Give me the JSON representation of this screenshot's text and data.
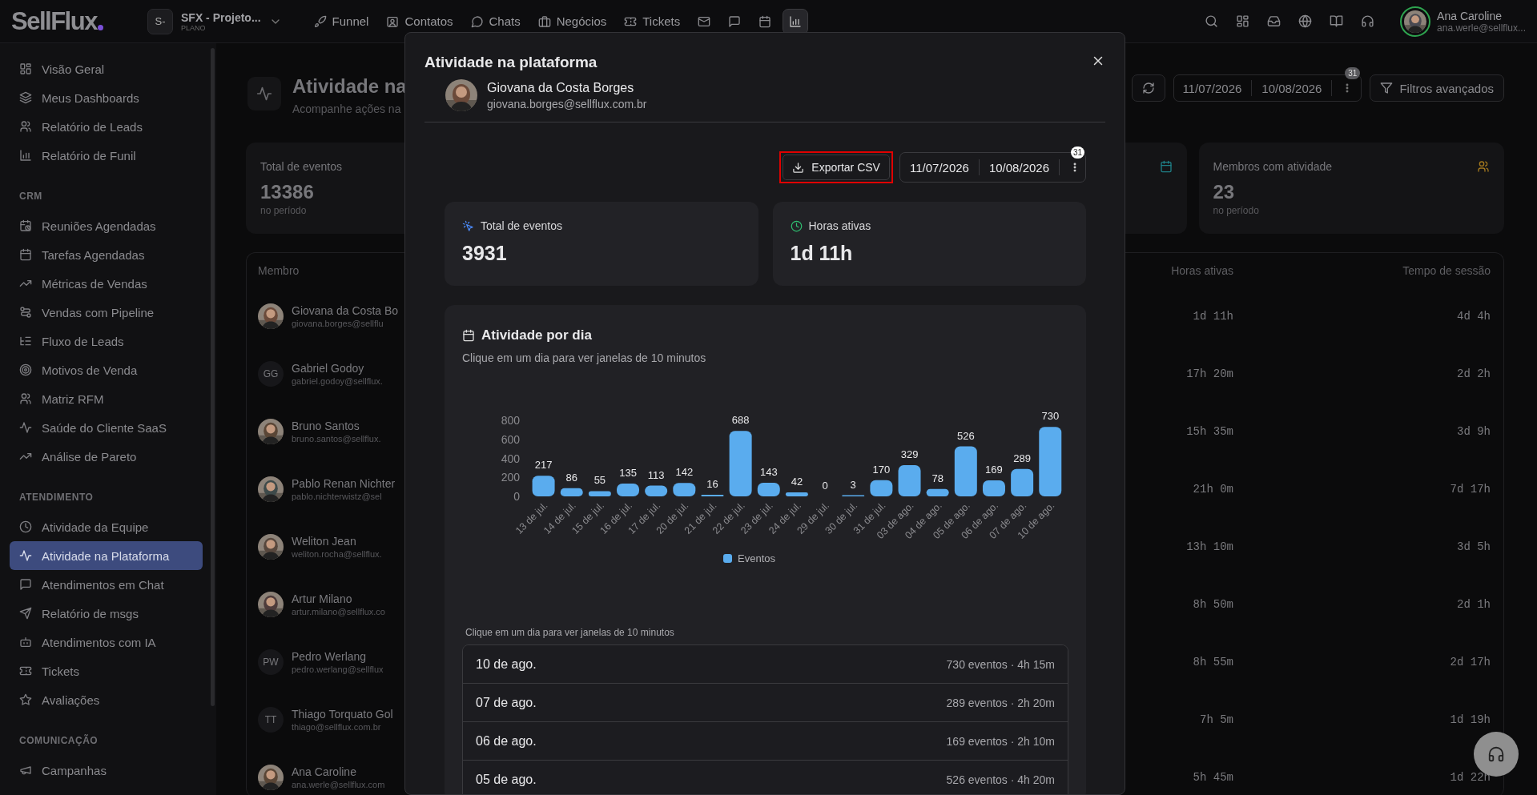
{
  "topbar": {
    "logo": "SellFlux",
    "workspace": {
      "badge": "S-",
      "name": "SFX - Projeto...",
      "plan": "PLANO"
    },
    "nav": [
      {
        "label": "Funnel",
        "selected": false
      },
      {
        "label": "Contatos",
        "selected": false
      },
      {
        "label": "Chats",
        "selected": false
      },
      {
        "label": "Negócios",
        "selected": false
      },
      {
        "label": "Tickets",
        "selected": false
      }
    ],
    "tools": [
      {
        "selected": false
      },
      {
        "selected": false
      },
      {
        "selected": false
      },
      {
        "selected": true
      }
    ],
    "user": {
      "name": "Ana Caroline",
      "email": "ana.werle@sellflux..."
    }
  },
  "sidebar": {
    "groups": [
      {
        "items": [
          {
            "label": "Visão Geral",
            "selected": false
          },
          {
            "label": "Meus Dashboards",
            "selected": false
          },
          {
            "label": "Relatório de Leads",
            "selected": false
          },
          {
            "label": "Relatório de Funil",
            "selected": false
          }
        ]
      },
      {
        "title": "CRM",
        "items": [
          {
            "label": "Reuniões Agendadas",
            "selected": false
          },
          {
            "label": "Tarefas Agendadas",
            "selected": false
          },
          {
            "label": "Métricas de Vendas",
            "selected": false
          },
          {
            "label": "Vendas com Pipeline",
            "selected": false
          },
          {
            "label": "Fluxo de Leads",
            "selected": false
          },
          {
            "label": "Motivos de Venda",
            "selected": false
          },
          {
            "label": "Matriz RFM",
            "selected": false
          },
          {
            "label": "Saúde do Cliente SaaS",
            "selected": false
          },
          {
            "label": "Análise de Pareto",
            "selected": false
          }
        ]
      },
      {
        "title": "ATENDIMENTO",
        "items": [
          {
            "label": "Atividade da Equipe",
            "selected": false
          },
          {
            "label": "Atividade na Plataforma",
            "selected": true
          },
          {
            "label": "Atendimentos em Chat",
            "selected": false
          },
          {
            "label": "Relatório de msgs",
            "selected": false
          },
          {
            "label": "Atendimentos com IA",
            "selected": false
          },
          {
            "label": "Tickets",
            "selected": false
          },
          {
            "label": "Avaliações",
            "selected": false
          }
        ]
      },
      {
        "title": "COMUNICAÇÃO",
        "items": [
          {
            "label": "Campanhas",
            "selected": false
          }
        ]
      }
    ]
  },
  "page": {
    "title": "Atividade na",
    "subtitle": "Acompanhe ações na",
    "date_range": {
      "start": "11/07/2026",
      "end": "10/08/2026",
      "badge": "31"
    },
    "filters_button": "Filtros avançados",
    "stat_cards": [
      {
        "label": "Total de eventos",
        "value": "13386",
        "note": "no período"
      },
      {
        "label": "Membros com atividade",
        "value": "23",
        "note": "no período"
      }
    ],
    "table": {
      "columns": [
        "Membro",
        "Horas ativas",
        "Tempo de sessão"
      ],
      "rows": [
        {
          "name": "Giovana da Costa Bo",
          "email": "giovana.borges@sellflu",
          "hours": "1d 11h",
          "session": "4d 4h"
        },
        {
          "kind": "initials",
          "initials": "GG",
          "name": "Gabriel Godoy",
          "email": "gabriel.godoy@sellflux.",
          "hours": "17h 20m",
          "session": "2d 2h"
        },
        {
          "name": "Bruno Santos",
          "email": "bruno.santos@sellflux.",
          "hours": "15h 35m",
          "session": "3d 9h"
        },
        {
          "name": "Pablo Renan Nichter",
          "email": "pablo.nichterwistz@sel",
          "hours": "21h 0m",
          "session": "7d 17h"
        },
        {
          "name": "Weliton Jean",
          "email": "weliton.rocha@sellflux.",
          "hours": "13h 10m",
          "session": "3d 5h"
        },
        {
          "name": "Artur Milano",
          "email": "artur.milano@sellflux.co",
          "hours": "8h 50m",
          "session": "2d 1h"
        },
        {
          "kind": "initials",
          "initials": "PW",
          "name": "Pedro Werlang",
          "email": "pedro.werlang@sellflux",
          "hours": "8h 55m",
          "session": "2d 17h"
        },
        {
          "kind": "initials",
          "initials": "TT",
          "name": "Thiago Torquato Gol",
          "email": "thiago@sellflux.com.br",
          "hours": "7h 5m",
          "session": "1d 19h"
        },
        {
          "name": "Ana Caroline",
          "email": "ana.werle@sellflux.com",
          "hours": "5h 45m",
          "session": "1d 22h"
        }
      ]
    }
  },
  "modal": {
    "title": "Atividade na plataforma",
    "member": {
      "name": "Giovana da Costa Borges",
      "email": "giovana.borges@sellflux.com.br"
    },
    "export_button": "Exportar CSV",
    "date_range": {
      "start": "11/07/2026",
      "end": "10/08/2026",
      "badge": "31"
    },
    "stats": [
      {
        "label": "Total de eventos",
        "value": "3931"
      },
      {
        "label": "Horas ativas",
        "value": "1d 11h"
      }
    ],
    "chart_panel": {
      "title": "Atividade por dia",
      "subtitle": "Clique em um dia para ver janelas de 10 minutos",
      "chart_data": {
        "type": "bar",
        "categories": [
          "13 de jul.",
          "14 de jul.",
          "15 de jul.",
          "16 de jul.",
          "17 de jul.",
          "20 de jul.",
          "21 de jul.",
          "22 de jul.",
          "23 de jul.",
          "24 de jul.",
          "29 de jul.",
          "30 de jul.",
          "31 de jul.",
          "03 de ago.",
          "04 de ago.",
          "05 de ago.",
          "06 de ago.",
          "07 de ago.",
          "10 de ago."
        ],
        "series": [
          {
            "name": "Eventos",
            "color": "#5aacee",
            "values": [
              217,
              86,
              55,
              135,
              113,
              142,
              16,
              688,
              143,
              42,
              0,
              3,
              170,
              329,
              78,
              526,
              169,
              289,
              730
            ]
          }
        ],
        "ylim": [
          0,
          800
        ],
        "yticks": [
          0,
          200,
          400,
          600,
          800
        ],
        "data_labels": true
      }
    },
    "days_hint": "Clique em um dia para ver janelas de 10 minutos",
    "days": [
      {
        "date": "10 de ago.",
        "summary": "730 eventos · 4h 15m"
      },
      {
        "date": "07 de ago.",
        "summary": "289 eventos · 2h 20m"
      },
      {
        "date": "06 de ago.",
        "summary": "169 eventos · 2h 10m"
      },
      {
        "date": "05 de ago.",
        "summary": "526 eventos · 4h 20m"
      }
    ]
  }
}
